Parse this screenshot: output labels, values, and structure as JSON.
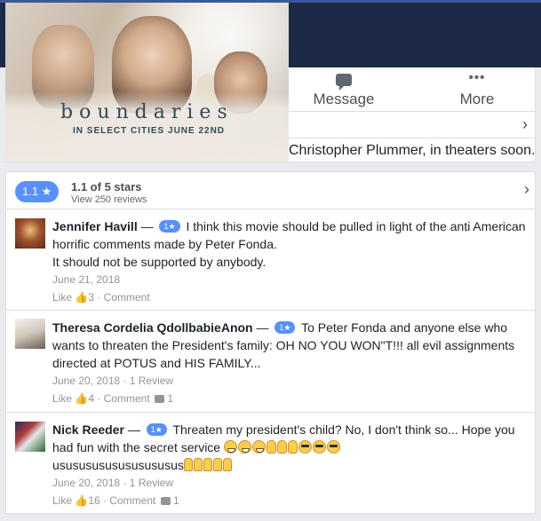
{
  "header": {
    "message_label": "Message",
    "more_label": "More",
    "about_snippet": "Christopher Plummer, in theaters soon."
  },
  "poster": {
    "title": "boundaries",
    "subtitle": "IN SELECT CITIES JUNE 22ND"
  },
  "summary": {
    "rating_badge": "1.1 ★",
    "title": "1.1 of 5 stars",
    "subtitle": "View 250 reviews"
  },
  "reviews": [
    {
      "name": "Jennifer Havill",
      "badge": "1★",
      "text_line1": "I think this movie should be pulled in light of the anti American horrific comments made by Peter Fonda.",
      "text_line2": "It should not be supported by anybody.",
      "date": "June 21, 2018",
      "like_label": "Like",
      "like_count": "3",
      "comment_label": "Comment",
      "comment_count": ""
    },
    {
      "name": "Theresa Cordelia QdollbabieAnon",
      "badge": "1★",
      "text_line1": "To Peter Fonda and anyone else who wants to threaten the President's family: OH NO YOU WON\"T!!! all evil assignments directed at POTUS and HIS FAMILY...",
      "date_line": "June 20, 2018 · 1 Review",
      "like_label": "Like",
      "like_count": "4",
      "comment_label": "Comment",
      "comment_count": "1"
    },
    {
      "name": "Nick Reeder",
      "badge": "1★",
      "text_line1": "Threaten my president's child? No, I don't think so... Hope you had fun with the secret service",
      "text_line2": "usususususususususus",
      "date_line": "June 20, 2018 · 1 Review",
      "like_label": "Like",
      "like_count": "16",
      "comment_label": "Comment",
      "comment_count": "1"
    }
  ]
}
